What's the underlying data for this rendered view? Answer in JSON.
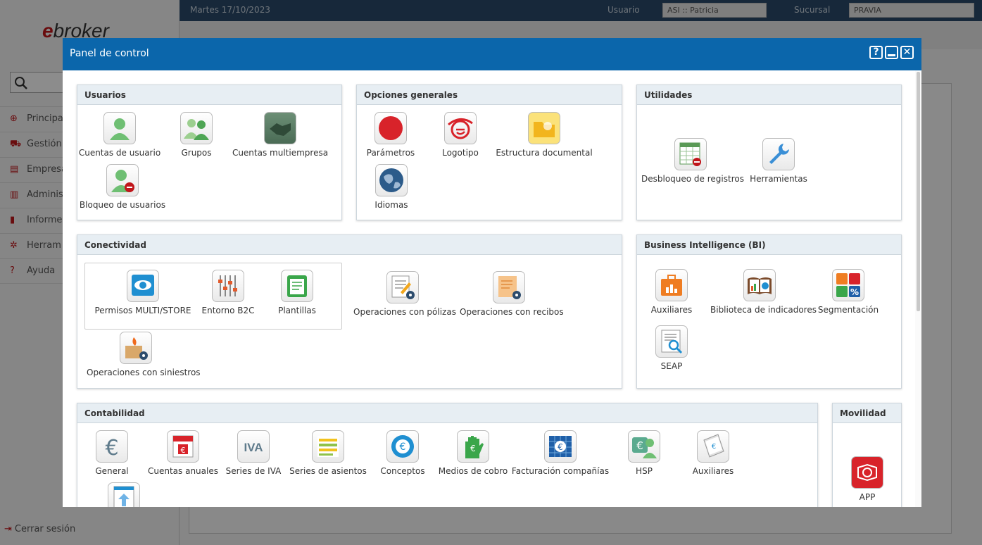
{
  "background": {
    "date": "Martes 17/10/2023",
    "user_label": "Usuario",
    "user_value": "ASI :: Patricia",
    "branch_label": "Sucursal",
    "branch_value": "PRAVIA",
    "logo_text": "ebroker",
    "nav": [
      "Principal",
      "Gestión",
      "Empresa",
      "Adminis",
      "Informe",
      "Herram",
      "Ayuda"
    ],
    "logout": "Cerrar sesión"
  },
  "dialog": {
    "title": "Panel de control",
    "help_button": "?",
    "minimize_button": "—",
    "close_button": "✕"
  },
  "panels": {
    "usuarios": {
      "title": "Usuarios",
      "items": [
        "Cuentas de usuario",
        "Grupos",
        "Cuentas multiempresa",
        "Bloqueo de usuarios"
      ]
    },
    "opciones": {
      "title": "Opciones generales",
      "items": [
        "Parámetros",
        "Logotipo",
        "Estructura documental",
        "Idiomas"
      ]
    },
    "utilidades": {
      "title": "Utilidades",
      "items": [
        "Desbloqueo de registros",
        "Herramientas"
      ]
    },
    "conectividad": {
      "title": "Conectividad",
      "items": [
        "Permisos MULTI/STORE",
        "Entorno B2C",
        "Plantillas",
        "Operaciones con pólizas",
        "Operaciones con recibos",
        "Operaciones con siniestros"
      ]
    },
    "bi": {
      "title": "Business Intelligence (BI)",
      "items": [
        "Auxiliares",
        "Biblioteca de indicadores",
        "Segmentación",
        "SEAP"
      ]
    },
    "contabilidad": {
      "title": "Contabilidad",
      "items": [
        "General",
        "Cuentas anuales",
        "Series de IVA",
        "Series de asientos",
        "Conceptos",
        "Medios de cobro",
        "Facturación compañías",
        "HSP",
        "Auxiliares"
      ]
    },
    "movilidad": {
      "title": "Movilidad",
      "items": [
        "APP"
      ]
    }
  },
  "icon_labels": {
    "iva": "IVA",
    "percent": "%",
    "euro": "€"
  },
  "colors": {
    "header": "#0b66ab",
    "brand_red": "#c0161b",
    "panel_head": "#e7eef3"
  }
}
